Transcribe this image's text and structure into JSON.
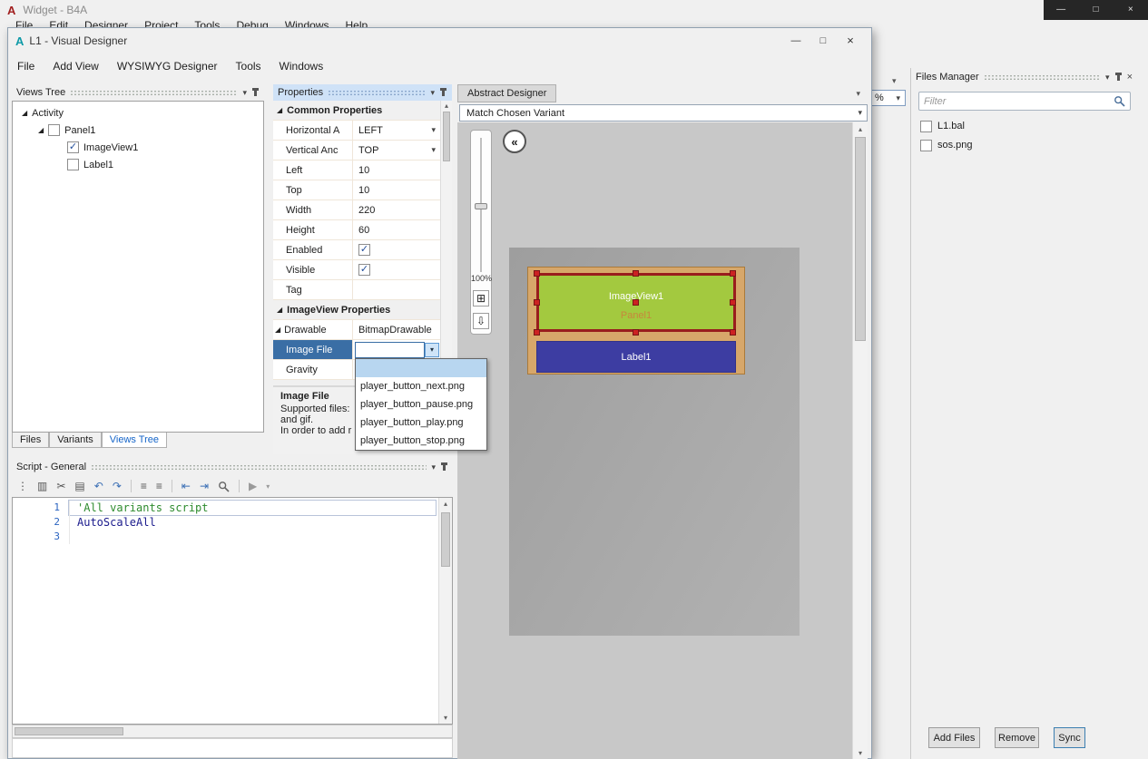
{
  "icons": {
    "minimize": "—",
    "maximize": "□",
    "close": "×",
    "chevron": "▾",
    "expander": "◢",
    "check": "✓",
    "back": "«",
    "grid": "⊞",
    "import": "⇩",
    "play": "▶",
    "copy": "▥",
    "cut": "✂",
    "paste": "▤",
    "undo": "↶",
    "redo": "↷",
    "list": "≡",
    "outdent": "⇤",
    "indent": "⇥",
    "grip": "⋮",
    "up": "▴",
    "down": "▾"
  },
  "bg_window": {
    "logo": "A",
    "title": "Widget - B4A",
    "menu": [
      "File",
      "Edit",
      "Designer",
      "Project",
      "Tools",
      "Debug",
      "Windows",
      "Help"
    ],
    "zoom_value": "%"
  },
  "designer": {
    "logo": "A",
    "title": "L1 - Visual Designer",
    "menu": [
      "File",
      "Add View",
      "WYSIWYG Designer",
      "Tools",
      "Windows"
    ],
    "views_tree": {
      "header": "Views Tree",
      "items": [
        {
          "label": "Activity"
        },
        {
          "label": "Panel1",
          "checked": false
        },
        {
          "label": "ImageView1",
          "checked": true
        },
        {
          "label": "Label1",
          "checked": false
        }
      ],
      "tabs": [
        "Files",
        "Variants",
        "Views Tree"
      ]
    },
    "properties": {
      "header": "Properties",
      "rows": [
        {
          "label": "Common Properties"
        },
        {
          "label": "Horizontal A",
          "value": "LEFT"
        },
        {
          "label": "Vertical Anc",
          "value": "TOP"
        },
        {
          "label": "Left",
          "value": "10"
        },
        {
          "label": "Top",
          "value": "10"
        },
        {
          "label": "Width",
          "value": "220"
        },
        {
          "label": "Height",
          "value": "60"
        },
        {
          "label": "Enabled",
          "checked": true
        },
        {
          "label": "Visible",
          "checked": true
        },
        {
          "label": "Tag",
          "value": ""
        },
        {
          "label": "ImageView Properties"
        },
        {
          "label": "Drawable",
          "value": "BitmapDrawable"
        },
        {
          "label": "Image File",
          "value": ""
        },
        {
          "label": "Gravity",
          "value": ""
        }
      ],
      "help": {
        "title": "Image File",
        "line1": "Supported files:",
        "line2": "and gif.",
        "line3": "In order to add r"
      }
    },
    "image_file_menu": {
      "items": [
        "",
        "player_button_next.png",
        "player_button_pause.png",
        "player_button_play.png",
        "player_button_stop.png"
      ]
    },
    "script": {
      "header": "Script - General",
      "lines": [
        {
          "num": "1",
          "code": "'All variants script"
        },
        {
          "num": "2",
          "code": "AutoScaleAll"
        },
        {
          "num": "3",
          "code": ""
        }
      ]
    },
    "abstract": {
      "tab": "Abstract Designer",
      "variant": "Match Chosen Variant",
      "zoom": "100%",
      "panel_label": "Panel1",
      "imageview_label": "ImageView1",
      "label_label": "Label1"
    }
  },
  "files_manager": {
    "header": "Files Manager",
    "filter_placeholder": "Filter",
    "files": [
      {
        "name": "L1.bal"
      },
      {
        "name": "sos.png"
      }
    ],
    "buttons": {
      "add": "Add Files",
      "remove": "Remove",
      "sync": "Sync"
    }
  }
}
